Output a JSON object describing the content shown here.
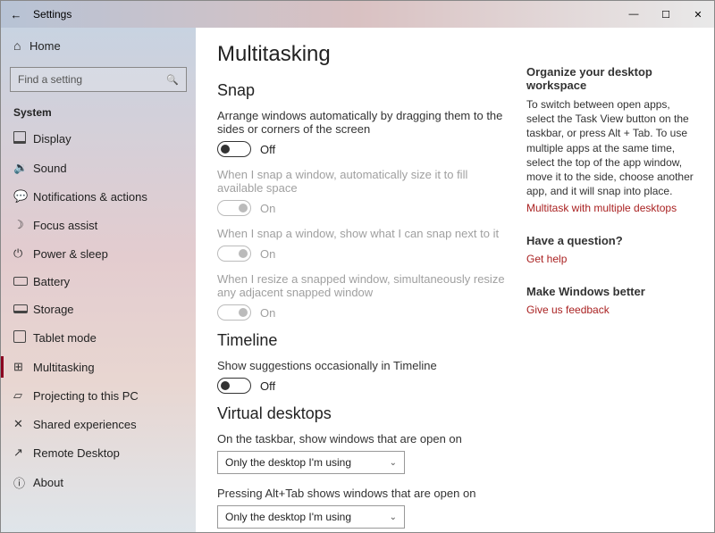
{
  "window": {
    "title": "Settings",
    "min": "—",
    "max": "☐",
    "close": "✕",
    "back": "←"
  },
  "home_label": "Home",
  "search_placeholder": "Find a setting",
  "category": "System",
  "nav": [
    {
      "label": "Display",
      "icon": "display"
    },
    {
      "label": "Sound",
      "icon": "sound"
    },
    {
      "label": "Notifications & actions",
      "icon": "bell"
    },
    {
      "label": "Focus assist",
      "icon": "moon"
    },
    {
      "label": "Power & sleep",
      "icon": "power"
    },
    {
      "label": "Battery",
      "icon": "batt"
    },
    {
      "label": "Storage",
      "icon": "store"
    },
    {
      "label": "Tablet mode",
      "icon": "tablet"
    },
    {
      "label": "Multitasking",
      "icon": "multi"
    },
    {
      "label": "Projecting to this PC",
      "icon": "proj"
    },
    {
      "label": "Shared experiences",
      "icon": "share"
    },
    {
      "label": "Remote Desktop",
      "icon": "remote"
    },
    {
      "label": "About",
      "icon": "about"
    }
  ],
  "page_title": "Multitasking",
  "snap": {
    "heading": "Snap",
    "s0": {
      "label": "Arrange windows automatically by dragging them to the sides or corners of the screen",
      "state": "Off"
    },
    "s1": {
      "label": "When I snap a window, automatically size it to fill available space",
      "state": "On"
    },
    "s2": {
      "label": "When I snap a window, show what I can snap next to it",
      "state": "On"
    },
    "s3": {
      "label": "When I resize a snapped window, simultaneously resize any adjacent snapped window",
      "state": "On"
    }
  },
  "timeline": {
    "heading": "Timeline",
    "t0": {
      "label": "Show suggestions occasionally in Timeline",
      "state": "Off"
    }
  },
  "vd": {
    "heading": "Virtual desktops",
    "q1": "On the taskbar, show windows that are open on",
    "v1": "Only the desktop I'm using",
    "q2": "Pressing Alt+Tab shows windows that are open on",
    "v2": "Only the desktop I'm using"
  },
  "aside": {
    "h1": "Organize your desktop workspace",
    "p1": "To switch between open apps, select the Task View button on the taskbar, or press Alt + Tab. To use multiple apps at the same time, select the top of the app window, move it to the side, choose another app, and it will snap into place.",
    "l1": "Multitask with multiple desktops",
    "h2": "Have a question?",
    "l2": "Get help",
    "h3": "Make Windows better",
    "l3": "Give us feedback"
  }
}
